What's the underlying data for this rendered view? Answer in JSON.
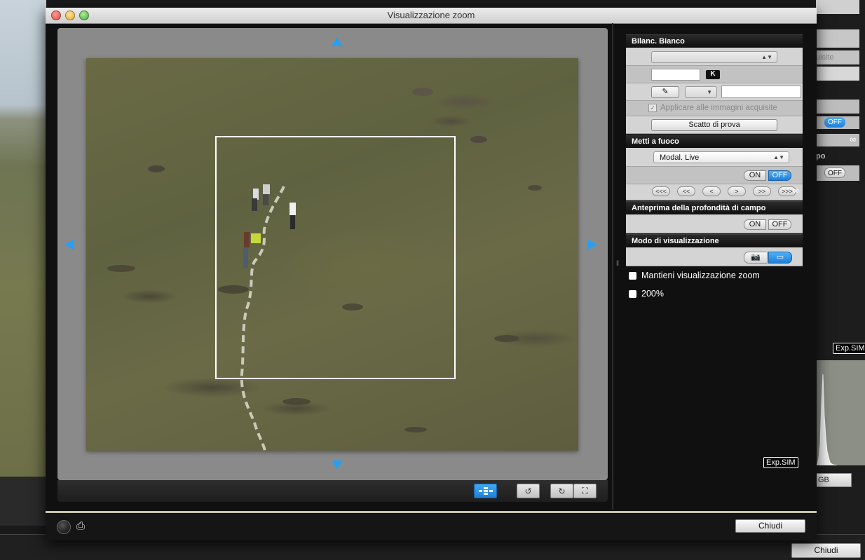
{
  "window": {
    "title": "Visualizzazione zoom"
  },
  "white_balance": {
    "header": "Bilanc. Bianco",
    "k_unit": "K",
    "apply_label": "Applicare alle immagini acquisite",
    "apply_checked": true,
    "test_shot_label": "Scatto di prova"
  },
  "focus": {
    "header": "Metti a fuoco",
    "mode_value": "Modal. Live",
    "on_label": "ON",
    "off_label": "OFF",
    "active": "OFF",
    "steps": [
      "<<<",
      "<<",
      "<",
      ">",
      ">>",
      ">>>"
    ],
    "infinity": "∞"
  },
  "depth_preview": {
    "header": "Anteprima della profondità di campo",
    "on_label": "ON",
    "off_label": "OFF"
  },
  "display_mode": {
    "header": "Modo di visualizzazione",
    "camera_icon": "camera-icon",
    "monitor_icon": "monitor-icon"
  },
  "options": {
    "keep_zoom_label": "Mantieni visualizzazione zoom",
    "zoom_200_label": "200%"
  },
  "exp_sim": "Exp.SIM",
  "footer": {
    "close_label": "Chiudi"
  },
  "background_app": {
    "exp_sim": "Exp.SIM",
    "close_label": "Chiudi",
    "off_label": "OFF",
    "snippet_acquisite": "uisite",
    "snippet_po": "po",
    "snippet_rgb": "GB",
    "infinity": "∞"
  },
  "colors": {
    "accent": "#2a9ff0",
    "panel_header": "#151515",
    "panel_row": "#c2c2c2"
  }
}
